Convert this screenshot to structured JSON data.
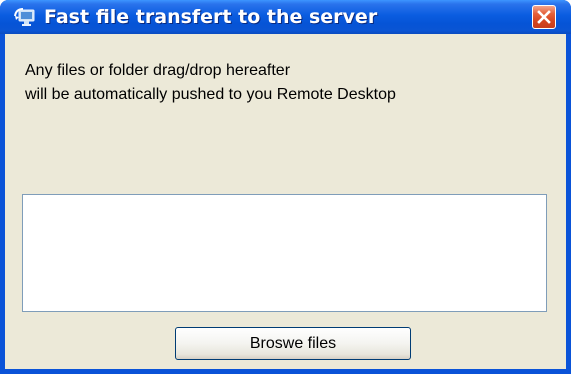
{
  "window": {
    "title": "Fast file transfert to the server",
    "title_icon": "remote-desktop-icon",
    "close_icon": "close-icon",
    "colors": {
      "titlebar": "#0a5ce0",
      "close_button": "#d4441e",
      "client_background": "#ece9d8",
      "drop_zone_border": "#7f9db9"
    }
  },
  "message": {
    "line1": "Any files or folder drag/drop hereafter",
    "line2": "will be automatically pushed to you Remote Desktop"
  },
  "drop_zone": {
    "items": []
  },
  "browse_button": {
    "label": "Broswe files"
  }
}
